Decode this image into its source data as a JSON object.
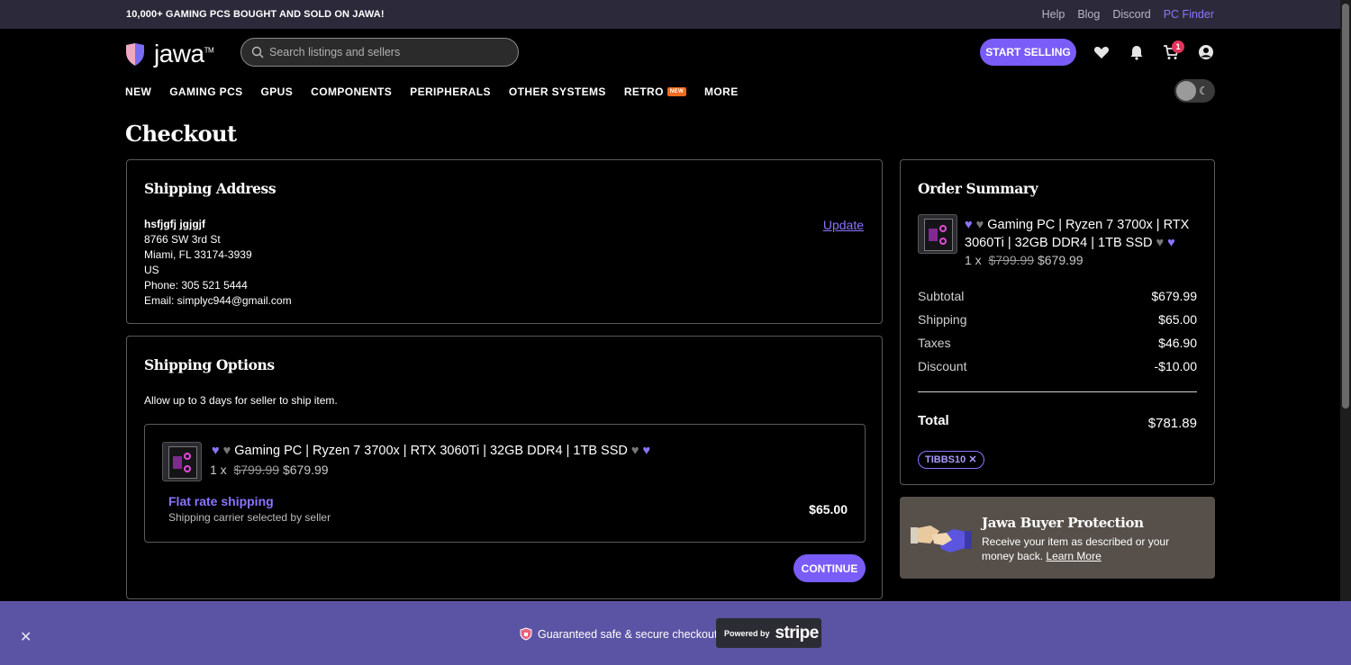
{
  "topbar": {
    "promo": "10,000+ GAMING PCS BOUGHT AND SOLD ON JAWA!",
    "links": [
      "Help",
      "Blog",
      "Discord"
    ],
    "finder": "PC Finder"
  },
  "header": {
    "logo_text": "jawa",
    "logo_tm": "TM",
    "search_placeholder": "Search listings and sellers",
    "sell_label": "START SELLING",
    "cart_count": "1"
  },
  "nav": {
    "items": [
      "NEW",
      "GAMING PCS",
      "GPUS",
      "COMPONENTS",
      "PERIPHERALS",
      "OTHER SYSTEMS",
      "RETRO",
      "MORE"
    ],
    "retro_badge": "NEW"
  },
  "page": {
    "title": "Checkout"
  },
  "shipping_address": {
    "title": "Shipping Address",
    "name": "hsfjgfj jgjgjf",
    "street": "8766 SW 3rd St",
    "city": "Miami, FL 33174-3939",
    "country": "US",
    "phone": "Phone: 305 521 5444",
    "email": "Email: simplyc944@gmail.com",
    "update_label": "Update"
  },
  "shipping_options": {
    "title": "Shipping Options",
    "note": "Allow up to 3 days for seller to ship item.",
    "product_title": "Gaming PC | Ryzen 7 3700x | RTX 3060Ti | 32GB DDR4 | 1TB SSD",
    "qty": "1 x",
    "old_price": "$799.99",
    "price": "$679.99",
    "method": "Flat rate shipping",
    "method_sub": "Shipping carrier selected by seller",
    "method_price": "$65.00",
    "continue_label": "CONTINUE"
  },
  "order_summary": {
    "title": "Order Summary",
    "product_title": "Gaming PC | Ryzen 7 3700x | RTX 3060Ti | 32GB DDR4 | 1TB SSD",
    "qty": "1 x",
    "old_price": "$799.99",
    "price": "$679.99",
    "subtotal_label": "Subtotal",
    "subtotal": "$679.99",
    "shipping_label": "Shipping",
    "shipping": "$65.00",
    "taxes_label": "Taxes",
    "taxes": "$46.90",
    "discount_label": "Discount",
    "discount": "-$10.00",
    "total_label": "Total",
    "total": "$781.89",
    "coupon": "TIBBS10"
  },
  "protection": {
    "title": "Jawa Buyer Protection",
    "text": "Receive your item as described or your money back.",
    "link": "Learn More"
  },
  "banner": {
    "secure_text": "Guaranteed safe & secure checkout",
    "powered_by": "Powered by",
    "stripe": "stripe"
  },
  "colors": {
    "accent": "#7a5cf8",
    "banner": "#5b53a3",
    "protection_bg": "#57504a"
  }
}
